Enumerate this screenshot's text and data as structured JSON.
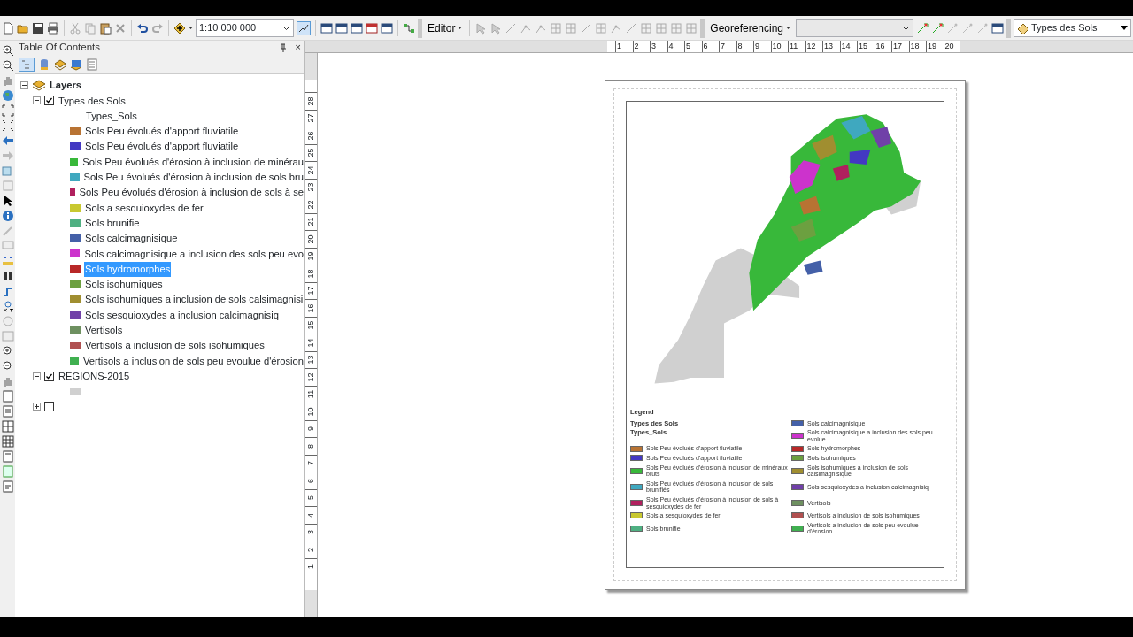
{
  "toolbar": {
    "scale": "1:10 000 000",
    "editor_menu": "Editor",
    "georef_menu": "Georeferencing",
    "layer_select": "Types des Sols"
  },
  "toc": {
    "title": "Table Of Contents",
    "close": "×",
    "tree": [
      {
        "kind": "frame",
        "label": "Layers",
        "expanded": true,
        "children": [
          {
            "kind": "layer",
            "label": "Types des Sols",
            "checked": true,
            "expanded": true,
            "field": "Types_Sols",
            "classes": [
              {
                "label": "Sols Peu évolués d'apport fluviatile",
                "color": "#b87333",
                "selected": false
              },
              {
                "label": "Sols Peu évolués d'apport fluviatile",
                "color": "#4338c2",
                "selected": false
              },
              {
                "label": "Sols Peu évolués d'érosion à inclusion de minérau",
                "color": "#38b83a",
                "selected": false
              },
              {
                "label": "Sols Peu évolués d'érosion à inclusion de sols bru",
                "color": "#3fa8bf",
                "selected": false
              },
              {
                "label": "Sols Peu évolués d'érosion à inclusion de sols à se",
                "color": "#b0205e",
                "selected": false
              },
              {
                "label": "Sols a sesquioxydes de fer",
                "color": "#c8c830",
                "selected": false
              },
              {
                "label": "Sols brunifie",
                "color": "#4fb082",
                "selected": false
              },
              {
                "label": "Sols calcimagnisique",
                "color": "#4460a8",
                "selected": false
              },
              {
                "label": "Sols calcimagnisique a inclusion des sols peu evo",
                "color": "#cc33cc",
                "selected": false
              },
              {
                "label": "Sols hydromorphes",
                "color": "#b82828",
                "selected": true
              },
              {
                "label": "Sols isohumiques",
                "color": "#6ca040",
                "selected": false
              },
              {
                "label": "Sols isohumiques a inclusion de sols calsimagnisi",
                "color": "#a08e30",
                "selected": false
              },
              {
                "label": "Sols sesquioxydes a inclusion calcimagnisiq",
                "color": "#7040a8",
                "selected": false
              },
              {
                "label": "Vertisols",
                "color": "#6e9060",
                "selected": false
              },
              {
                "label": "Vertisols a inclusion de sols isohumiques",
                "color": "#b05050",
                "selected": false
              },
              {
                "label": "Vertisols a inclusion de sols peu evoulue d'érosion",
                "color": "#40b050",
                "selected": false
              }
            ]
          },
          {
            "kind": "layer",
            "label": "REGIONS-2015",
            "checked": true,
            "expanded": true,
            "classes": [
              {
                "color": "#d0d0d0",
                "selected": false
              }
            ]
          },
          {
            "kind": "layer",
            "checked": false,
            "expanded": false
          }
        ]
      }
    ]
  },
  "layout": {
    "top_ruler": [
      "1",
      "2",
      "3",
      "4",
      "5",
      "6",
      "7",
      "8",
      "9",
      "10",
      "11",
      "12",
      "13",
      "14",
      "15",
      "16",
      "17",
      "18",
      "19",
      "20"
    ],
    "left_ruler": [
      "28",
      "27",
      "26",
      "25",
      "24",
      "23",
      "22",
      "21",
      "20",
      "19",
      "18",
      "17",
      "16",
      "15",
      "14",
      "13",
      "12",
      "11",
      "10",
      "9",
      "8",
      "7",
      "6",
      "5",
      "4",
      "3",
      "2",
      "1"
    ],
    "legend": {
      "title": "Legend",
      "layer": "Types des Sols",
      "field": "Types_Sols",
      "items": [
        {
          "label": "Sols Peu évolués d'apport fluviatile",
          "color": "#b87333"
        },
        {
          "label": "Sols Peu évolués d'apport fluviatile",
          "color": "#4338c2"
        },
        {
          "label": "Sols Peu évolués d'érosion à inclusion de minéraux bruts",
          "color": "#38b83a"
        },
        {
          "label": "Sols Peu évolués d'érosion à inclusion de sols brunifiés",
          "color": "#3fa8bf"
        },
        {
          "label": "Sols Peu évolués d'érosion à inclusion de sols à sesquioxydes de fer",
          "color": "#b0205e"
        },
        {
          "label": "Sols a sesquioxydes de fer",
          "color": "#c8c830"
        },
        {
          "label": "Sols brunifie",
          "color": "#4fb082"
        },
        {
          "label": "Sols calcimagnisique",
          "color": "#4460a8"
        },
        {
          "label": "Sols calcimagnisique a inclusion des sols peu evolue",
          "color": "#cc33cc"
        },
        {
          "label": "Sols hydromorphes",
          "color": "#b82828"
        },
        {
          "label": "Sols isohumiques",
          "color": "#6ca040"
        },
        {
          "label": "Sols isohumiques a inclusion de sols calsimagnisique",
          "color": "#a08e30"
        },
        {
          "label": "Sols sesquioxydes a inclusion calcimagnisiq",
          "color": "#7040a8"
        },
        {
          "label": "Vertisols",
          "color": "#6e9060"
        },
        {
          "label": "Vertisols a inclusion de sols isohumiques",
          "color": "#b05050"
        },
        {
          "label": "Vertisols a inclusion de sols peu evoulue d'érosion",
          "color": "#40b050"
        }
      ]
    }
  }
}
